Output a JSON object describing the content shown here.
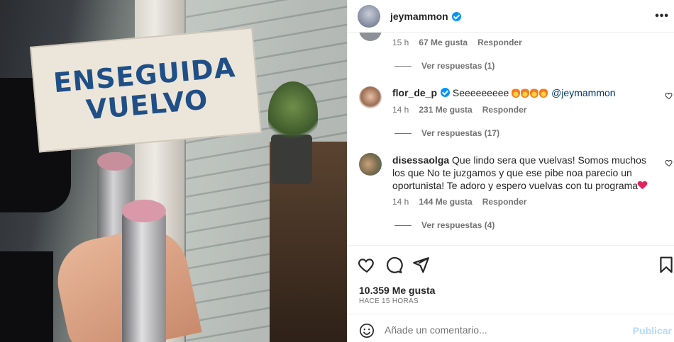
{
  "photo": {
    "sign_line1": "ENSEGUIDA",
    "sign_line2": "VUELVO"
  },
  "header": {
    "username": "jeymammon",
    "verified": true,
    "more_icon": "more-horizontal-icon"
  },
  "comments": [
    {
      "id": "partial",
      "time": "15 h",
      "likes": "67 Me gusta",
      "reply": "Responder",
      "view_replies": "Ver respuestas (1)"
    },
    {
      "id": "flor",
      "username": "flor_de_p",
      "verified": true,
      "text": "Seeeeeeeee",
      "mention": "@jeymammon",
      "time": "14 h",
      "likes": "231 Me gusta",
      "reply": "Responder",
      "view_replies": "Ver respuestas (17)"
    },
    {
      "id": "disessa",
      "username": "disessaolga",
      "text": "Que lindo sera que vuelvas! Somos muchos los que No te juzgamos y que ese pibe noa parecio un oportunista! Te adoro y espero vuelvas con tu programa",
      "time": "14 h",
      "likes": "144 Me gusta",
      "reply": "Responder",
      "view_replies": "Ver respuestas (4)"
    }
  ],
  "actions": {
    "likes": "10.359 Me gusta",
    "time": "HACE 15 HORAS"
  },
  "composer": {
    "placeholder": "Añade un comentario...",
    "publish": "Publicar"
  }
}
